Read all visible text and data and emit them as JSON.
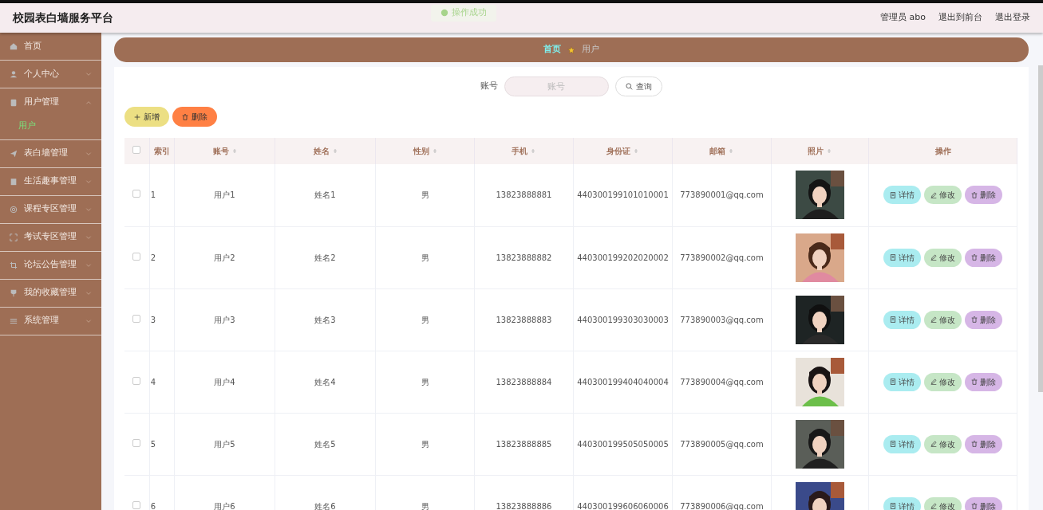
{
  "app_title": "校园表白墙服务平台",
  "toast": {
    "text": "操作成功"
  },
  "header_links": [
    {
      "label": "管理员 abo"
    },
    {
      "label": "退出到前台"
    },
    {
      "label": "退出登录"
    }
  ],
  "sidebar": {
    "items": [
      {
        "label": "首页",
        "kind": "link"
      },
      {
        "label": "个人中心",
        "kind": "menu",
        "expanded": false
      },
      {
        "label": "用户管理",
        "kind": "menu",
        "expanded": true,
        "children": [
          {
            "label": "用户",
            "selected": true
          }
        ]
      },
      {
        "label": "表白墙管理",
        "kind": "menu",
        "expanded": false
      },
      {
        "label": "生活趣事管理",
        "kind": "menu",
        "expanded": false
      },
      {
        "label": "课程专区管理",
        "kind": "menu",
        "expanded": false
      },
      {
        "label": "考试专区管理",
        "kind": "menu",
        "expanded": false
      },
      {
        "label": "论坛公告管理",
        "kind": "menu",
        "expanded": false
      },
      {
        "label": "我的收藏管理",
        "kind": "menu",
        "expanded": false
      },
      {
        "label": "系统管理",
        "kind": "menu",
        "expanded": false
      }
    ]
  },
  "breadcrumb": [
    {
      "label": "首页",
      "selected": false
    },
    {
      "label": "用户",
      "selected": true
    }
  ],
  "search": {
    "label": "账号",
    "placeholder": "账号",
    "button": "查询"
  },
  "toolbar": [
    {
      "label": "新增",
      "kind": "add"
    },
    {
      "label": "删除",
      "kind": "delete"
    }
  ],
  "table": {
    "all_checked": false,
    "columns": [
      {
        "label": "索引",
        "sortable": false
      },
      {
        "label": "账号",
        "sortable": true
      },
      {
        "label": "姓名",
        "sortable": true
      },
      {
        "label": "性别",
        "sortable": true
      },
      {
        "label": "手机",
        "sortable": true
      },
      {
        "label": "身份证",
        "sortable": true
      },
      {
        "label": "邮箱",
        "sortable": true
      },
      {
        "label": "照片",
        "sortable": true
      },
      {
        "label": "操作",
        "sortable": false
      }
    ],
    "rows": [
      {
        "checked": false,
        "index": "1",
        "account": "用户1",
        "name": "姓名1",
        "gender": "男",
        "phone": "13823888881",
        "id_card": "440300199101010001",
        "email": "773890001@qq.com",
        "actions": [
          {
            "label": "详情",
            "kind": "detail"
          },
          {
            "label": "修改",
            "kind": "edit"
          },
          {
            "label": "删除",
            "kind": "delete"
          }
        ]
      },
      {
        "checked": false,
        "index": "2",
        "account": "用户2",
        "name": "姓名2",
        "gender": "男",
        "phone": "13823888882",
        "id_card": "440300199202020002",
        "email": "773890002@qq.com",
        "actions": [
          {
            "label": "详情",
            "kind": "detail"
          },
          {
            "label": "修改",
            "kind": "edit"
          },
          {
            "label": "删除",
            "kind": "delete"
          }
        ]
      },
      {
        "checked": false,
        "index": "3",
        "account": "用户3",
        "name": "姓名3",
        "gender": "男",
        "phone": "13823888883",
        "id_card": "440300199303030003",
        "email": "773890003@qq.com",
        "actions": [
          {
            "label": "详情",
            "kind": "detail"
          },
          {
            "label": "修改",
            "kind": "edit"
          },
          {
            "label": "删除",
            "kind": "delete"
          }
        ]
      },
      {
        "checked": false,
        "index": "4",
        "account": "用户4",
        "name": "姓名4",
        "gender": "男",
        "phone": "13823888884",
        "id_card": "440300199404040004",
        "email": "773890004@qq.com",
        "actions": [
          {
            "label": "详情",
            "kind": "detail"
          },
          {
            "label": "修改",
            "kind": "edit"
          },
          {
            "label": "删除",
            "kind": "delete"
          }
        ]
      },
      {
        "checked": false,
        "index": "5",
        "account": "用户5",
        "name": "姓名5",
        "gender": "男",
        "phone": "13823888885",
        "id_card": "440300199505050005",
        "email": "773890005@qq.com",
        "actions": [
          {
            "label": "详情",
            "kind": "detail"
          },
          {
            "label": "修改",
            "kind": "edit"
          },
          {
            "label": "删除",
            "kind": "delete"
          }
        ]
      },
      {
        "checked": false,
        "index": "6",
        "account": "用户6",
        "name": "姓名6",
        "gender": "男",
        "phone": "13823888886",
        "id_card": "440300199606060006",
        "email": "773890006@qq.com",
        "actions": [
          {
            "label": "详情",
            "kind": "detail"
          },
          {
            "label": "修改",
            "kind": "edit"
          },
          {
            "label": "删除",
            "kind": "delete"
          }
        ]
      }
    ]
  }
}
